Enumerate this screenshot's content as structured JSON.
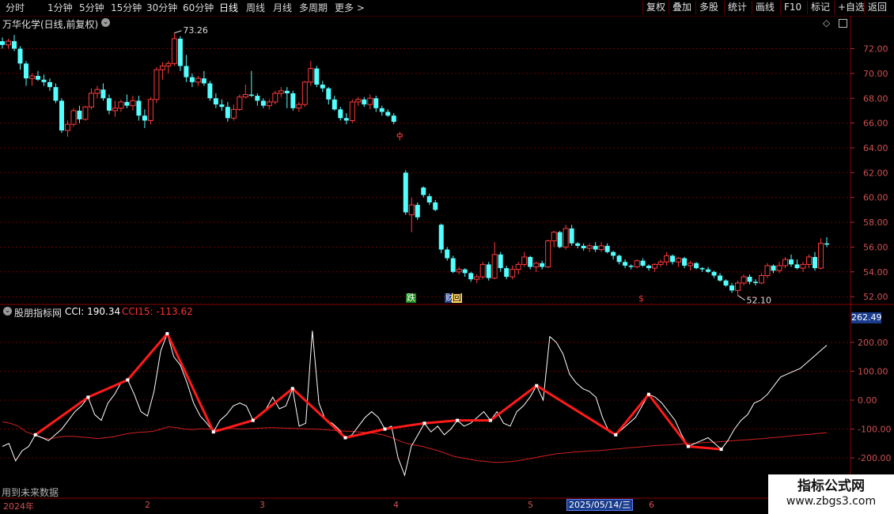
{
  "toolbar": {
    "periods": [
      "分时",
      "1分钟",
      "5分钟",
      "15分钟",
      "30分钟",
      "60分钟",
      "日线",
      "周线",
      "月线",
      "多周期",
      "更多 >"
    ],
    "active_period": "日线",
    "right_buttons": [
      "复权",
      "叠加",
      "多股",
      "统计",
      "画线",
      "F10",
      "标记",
      "+自选",
      "返回"
    ]
  },
  "stock": {
    "title": "万华化学(日线,前复权)",
    "high_label": "73.26",
    "low_label": "52.10",
    "price_ticks": [
      "72.00",
      "70.00",
      "68.00",
      "66.00",
      "64.00",
      "62.00",
      "60.00",
      "58.00",
      "56.00",
      "54.00",
      "52.00"
    ],
    "markers": [
      {
        "text": "跌",
        "color": "#ffffff",
        "bg": "#1a8a1a"
      },
      {
        "text": "财",
        "color": "#ffffff",
        "bg": "#1a3c8c"
      },
      {
        "text": "回",
        "color": "#000000",
        "bg": "#ffd86a"
      },
      {
        "text": "$",
        "color": "#ff3030",
        "bg": "transparent"
      }
    ]
  },
  "indicator": {
    "name": "股朋指标网",
    "cci_label": "CCI: 190.34",
    "cci15_label": "CCI15: -113.62",
    "ticks": [
      "200.00",
      "100.00",
      "0.00",
      "-100.00",
      "-200.00"
    ],
    "current_value": "262.49",
    "bottom_note": "用到未来数据"
  },
  "timeline": {
    "labels": [
      "2024年",
      "2",
      "3",
      "4",
      "5",
      "6"
    ],
    "cursor_date": "2025/05/14/三"
  },
  "watermark": {
    "line1": "指标公式网",
    "line2": "www.zbgs3.com"
  },
  "colors": {
    "up": "#ff3b3b",
    "down": "#54ffff",
    "grid": "#6a0000",
    "cci": "#ffffff",
    "cci15": "#d02020",
    "zigzag": "#ff1a1a"
  },
  "chart_data": [
    {
      "type": "candlestick",
      "title": "万华化学(日线,前复权)",
      "ylim": [
        51.5,
        73.5
      ],
      "candles": [
        [
          72.6,
          72.9,
          72.0,
          72.3
        ],
        [
          72.3,
          72.8,
          72.0,
          72.6
        ],
        [
          72.6,
          73.1,
          71.8,
          72.0
        ],
        [
          72.0,
          72.2,
          70.3,
          70.8
        ],
        [
          70.8,
          71.0,
          69.0,
          69.6
        ],
        [
          69.6,
          70.0,
          69.0,
          69.8
        ],
        [
          69.8,
          70.2,
          69.4,
          69.5
        ],
        [
          69.5,
          69.9,
          69.0,
          69.3
        ],
        [
          69.3,
          69.6,
          68.6,
          68.9
        ],
        [
          68.9,
          69.2,
          67.6,
          67.8
        ],
        [
          67.8,
          68.0,
          65.2,
          65.4
        ],
        [
          65.4,
          66.2,
          64.9,
          65.9
        ],
        [
          65.9,
          67.2,
          65.7,
          67.0
        ],
        [
          67.0,
          67.4,
          66.0,
          66.3
        ],
        [
          66.3,
          67.4,
          66.2,
          67.3
        ],
        [
          67.3,
          68.8,
          67.1,
          68.4
        ],
        [
          68.4,
          69.0,
          68.0,
          68.7
        ],
        [
          68.7,
          69.2,
          67.8,
          68.0
        ],
        [
          68.0,
          68.3,
          66.7,
          67.0
        ],
        [
          67.0,
          67.8,
          66.5,
          67.2
        ],
        [
          67.2,
          67.9,
          66.9,
          67.7
        ],
        [
          67.7,
          68.3,
          67.2,
          67.4
        ],
        [
          67.4,
          68.2,
          67.0,
          67.8
        ],
        [
          67.8,
          68.2,
          66.2,
          66.6
        ],
        [
          66.6,
          67.1,
          65.6,
          66.2
        ],
        [
          66.2,
          68.1,
          65.9,
          67.9
        ],
        [
          67.9,
          70.5,
          67.6,
          70.3
        ],
        [
          70.3,
          70.9,
          69.5,
          70.6
        ],
        [
          70.6,
          71.0,
          70.0,
          70.8
        ],
        [
          70.8,
          73.26,
          70.6,
          72.8
        ],
        [
          72.8,
          73.0,
          70.2,
          70.6
        ],
        [
          70.6,
          71.5,
          69.3,
          69.7
        ],
        [
          69.7,
          70.0,
          68.9,
          69.3
        ],
        [
          69.3,
          69.8,
          69.0,
          69.6
        ],
        [
          69.6,
          70.2,
          69.0,
          69.2
        ],
        [
          69.2,
          69.4,
          67.8,
          68.0
        ],
        [
          68.0,
          68.4,
          67.2,
          67.5
        ],
        [
          67.5,
          67.9,
          67.0,
          67.3
        ],
        [
          67.3,
          67.7,
          66.1,
          66.4
        ],
        [
          66.4,
          67.5,
          66.2,
          67.1
        ],
        [
          67.1,
          68.3,
          67.0,
          68.1
        ],
        [
          68.1,
          69.1,
          68.0,
          68.3
        ],
        [
          68.3,
          70.2,
          68.1,
          68.2
        ],
        [
          68.2,
          68.4,
          67.4,
          67.8
        ],
        [
          67.8,
          68.0,
          67.2,
          67.4
        ],
        [
          67.4,
          67.9,
          67.1,
          67.7
        ],
        [
          67.7,
          68.6,
          67.5,
          68.4
        ],
        [
          68.4,
          68.9,
          68.1,
          68.6
        ],
        [
          68.6,
          68.9,
          67.2,
          68.4
        ],
        [
          68.4,
          68.6,
          67.0,
          67.2
        ],
        [
          67.2,
          67.7,
          66.9,
          67.5
        ],
        [
          67.5,
          69.4,
          67.3,
          69.3
        ],
        [
          69.3,
          71.0,
          69.0,
          70.4
        ],
        [
          70.4,
          70.6,
          68.9,
          69.1
        ],
        [
          69.1,
          69.4,
          68.5,
          68.8
        ],
        [
          68.8,
          68.9,
          67.5,
          67.9
        ],
        [
          67.9,
          68.2,
          67.0,
          67.1
        ],
        [
          67.1,
          67.3,
          66.2,
          66.4
        ],
        [
          66.4,
          66.8,
          65.9,
          66.2
        ],
        [
          66.2,
          67.9,
          66.0,
          67.7
        ],
        [
          67.7,
          68.1,
          67.4,
          67.9
        ],
        [
          67.9,
          68.1,
          67.3,
          67.5
        ],
        [
          67.5,
          68.3,
          67.1,
          68.0
        ],
        [
          68.0,
          68.2,
          66.9,
          67.2
        ],
        [
          67.2,
          67.4,
          66.6,
          66.9
        ],
        [
          66.9,
          67.1,
          66.5,
          66.6
        ],
        [
          66.6,
          66.8,
          65.9,
          66.1
        ],
        [
          64.9,
          65.3,
          64.6,
          65.1
        ],
        [
          62.0,
          62.2,
          58.6,
          58.8
        ],
        [
          58.6,
          60.0,
          57.2,
          59.4
        ],
        [
          59.4,
          59.6,
          58.2,
          58.4
        ],
        [
          60.8,
          60.9,
          60.0,
          60.2
        ],
        [
          60.1,
          60.3,
          59.4,
          59.6
        ],
        [
          59.6,
          59.8,
          58.9,
          59.0
        ],
        [
          57.8,
          57.9,
          55.5,
          55.8
        ],
        [
          55.8,
          56.0,
          54.9,
          55.1
        ],
        [
          55.1,
          55.3,
          53.9,
          54.0
        ],
        [
          54.0,
          54.4,
          53.8,
          54.2
        ],
        [
          54.2,
          54.3,
          53.6,
          53.9
        ],
        [
          53.9,
          54.0,
          53.2,
          53.4
        ],
        [
          53.4,
          53.8,
          53.1,
          53.6
        ],
        [
          53.6,
          54.8,
          53.4,
          54.6
        ],
        [
          54.6,
          54.8,
          53.3,
          53.5
        ],
        [
          53.5,
          56.4,
          53.4,
          55.4
        ],
        [
          55.4,
          55.6,
          54.0,
          54.3
        ],
        [
          54.3,
          54.5,
          53.4,
          53.6
        ],
        [
          53.6,
          54.5,
          53.4,
          54.2
        ],
        [
          54.2,
          54.8,
          53.8,
          54.6
        ],
        [
          54.6,
          55.6,
          54.4,
          55.2
        ],
        [
          55.2,
          55.3,
          54.2,
          54.4
        ],
        [
          54.4,
          54.8,
          54.0,
          54.7
        ],
        [
          54.7,
          54.9,
          54.2,
          54.4
        ],
        [
          54.4,
          56.6,
          54.3,
          56.5
        ],
        [
          56.5,
          57.3,
          56.0,
          57.2
        ],
        [
          57.2,
          57.3,
          55.9,
          56.0
        ],
        [
          56.0,
          57.8,
          55.8,
          57.5
        ],
        [
          57.5,
          57.8,
          56.1,
          56.3
        ],
        [
          56.3,
          56.4,
          55.9,
          56.1
        ],
        [
          56.1,
          56.3,
          55.7,
          55.9
        ],
        [
          55.9,
          56.3,
          55.6,
          56.1
        ],
        [
          56.1,
          56.4,
          55.6,
          55.8
        ],
        [
          55.8,
          56.4,
          55.6,
          56.1
        ],
        [
          56.1,
          56.3,
          55.5,
          55.6
        ],
        [
          55.6,
          55.7,
          55.0,
          55.3
        ],
        [
          55.3,
          55.4,
          54.6,
          54.8
        ],
        [
          54.8,
          55.0,
          54.3,
          54.5
        ],
        [
          54.5,
          54.6,
          54.2,
          54.4
        ],
        [
          54.4,
          55.0,
          54.3,
          54.9
        ],
        [
          54.9,
          55.1,
          54.4,
          54.5
        ],
        [
          54.5,
          54.6,
          54.1,
          54.3
        ],
        [
          54.3,
          54.7,
          54.0,
          54.6
        ],
        [
          54.6,
          55.0,
          54.4,
          54.8
        ],
        [
          54.8,
          55.6,
          54.5,
          55.3
        ],
        [
          55.3,
          55.4,
          54.6,
          54.8
        ],
        [
          54.8,
          55.2,
          54.4,
          55.1
        ],
        [
          55.1,
          55.2,
          54.3,
          54.5
        ],
        [
          54.5,
          54.9,
          54.1,
          54.7
        ],
        [
          54.7,
          54.8,
          54.2,
          54.3
        ],
        [
          54.3,
          54.4,
          54.0,
          54.2
        ],
        [
          54.2,
          54.4,
          53.9,
          54.0
        ],
        [
          54.0,
          54.1,
          53.5,
          53.7
        ],
        [
          53.7,
          53.9,
          53.2,
          53.3
        ],
        [
          53.3,
          53.4,
          52.8,
          52.9
        ],
        [
          52.9,
          53.1,
          52.3,
          52.5
        ],
        [
          52.5,
          53.3,
          52.1,
          53.1
        ],
        [
          53.1,
          53.8,
          52.9,
          53.6
        ],
        [
          53.6,
          53.8,
          53.0,
          53.2
        ],
        [
          53.2,
          53.4,
          52.9,
          53.1
        ],
        [
          53.1,
          53.9,
          53.0,
          53.7
        ],
        [
          53.7,
          54.7,
          53.5,
          54.5
        ],
        [
          54.5,
          54.6,
          53.9,
          54.1
        ],
        [
          54.1,
          54.8,
          53.9,
          54.5
        ],
        [
          54.5,
          55.2,
          54.3,
          55.0
        ],
        [
          55.0,
          55.4,
          54.4,
          54.6
        ],
        [
          54.6,
          55.0,
          54.2,
          54.3
        ],
        [
          54.3,
          54.8,
          54.0,
          54.6
        ],
        [
          54.6,
          55.4,
          54.3,
          55.2
        ],
        [
          55.2,
          55.6,
          54.1,
          54.3
        ],
        [
          54.3,
          56.7,
          54.2,
          56.3
        ],
        [
          56.3,
          56.8,
          56.0,
          56.2
        ]
      ]
    },
    {
      "type": "line",
      "title": "股朋指标网",
      "ylim": [
        -290,
        290
      ],
      "series": [
        {
          "name": "CCI",
          "values": [
            -160,
            -150,
            -210,
            -175,
            -160,
            -120,
            -130,
            -140,
            -120,
            -100,
            -70,
            -40,
            -20,
            10,
            -50,
            -70,
            -10,
            20,
            60,
            70,
            20,
            -40,
            -55,
            30,
            170,
            230,
            150,
            120,
            60,
            -10,
            -55,
            -80,
            -110,
            -70,
            -50,
            -20,
            -10,
            -20,
            -70,
            -50,
            -30,
            10,
            -30,
            -20,
            40,
            -90,
            -80,
            240,
            -10,
            -70,
            -80,
            -100,
            -130,
            -120,
            -90,
            -60,
            -40,
            -60,
            -100,
            -90,
            -200,
            -260,
            -160,
            -120,
            -80,
            -110,
            -90,
            -120,
            -100,
            -70,
            -90,
            -80,
            -60,
            -40,
            -70,
            -40,
            -80,
            -90,
            -40,
            -20,
            10,
            50,
            0,
            220,
            200,
            160,
            90,
            60,
            40,
            30,
            10,
            -60,
            -110,
            -120,
            -100,
            -80,
            -60,
            -20,
            20,
            10,
            -10,
            -40,
            -70,
            -120,
            -160,
            -150,
            -140,
            -130,
            -150,
            -170,
            -140,
            -100,
            -70,
            -50,
            -10,
            0,
            20,
            50,
            80,
            90,
            100,
            110,
            130,
            150,
            170,
            190
          ]
        },
        {
          "name": "CCI15",
          "values": [
            -75,
            -80,
            -90,
            -110,
            -120,
            -130,
            -135,
            -128,
            -125,
            -125,
            -128,
            -130,
            -133,
            -130,
            -127,
            -120,
            -115,
            -112,
            -110,
            -108,
            -100,
            -92,
            -95,
            -100,
            -102,
            -99,
            -100,
            -102,
            -100,
            -98,
            -100,
            -99,
            -98,
            -96,
            -95,
            -96,
            -97,
            -98,
            -99,
            -100,
            -101,
            -103,
            -105,
            -107,
            -108,
            -110,
            -112,
            -115,
            -120,
            -128,
            -140,
            -150,
            -155,
            -160,
            -168,
            -175,
            -185,
            -195,
            -200,
            -205,
            -210,
            -212,
            -215,
            -215,
            -213,
            -210,
            -205,
            -200,
            -195,
            -190,
            -185,
            -183,
            -180,
            -178,
            -176,
            -175,
            -173,
            -170,
            -168,
            -165,
            -163,
            -161,
            -158,
            -156,
            -155,
            -153,
            -151,
            -150,
            -148,
            -146,
            -145,
            -143,
            -141,
            -139,
            -137,
            -135,
            -133,
            -130,
            -128,
            -125,
            -122,
            -120,
            -118,
            -115,
            -113
          ]
        }
      ]
    }
  ]
}
